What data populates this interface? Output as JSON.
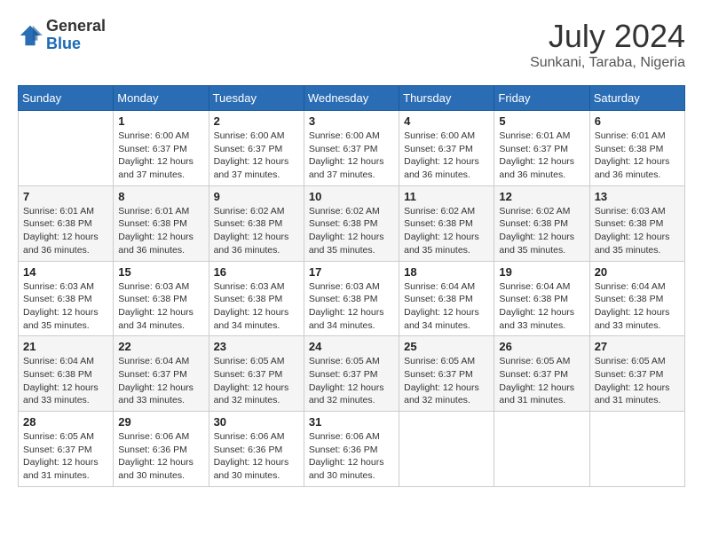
{
  "header": {
    "logo_general": "General",
    "logo_blue": "Blue",
    "month": "July 2024",
    "location": "Sunkani, Taraba, Nigeria"
  },
  "days_of_week": [
    "Sunday",
    "Monday",
    "Tuesday",
    "Wednesday",
    "Thursday",
    "Friday",
    "Saturday"
  ],
  "weeks": [
    [
      {
        "day": "",
        "sunrise": "",
        "sunset": "",
        "daylight": ""
      },
      {
        "day": "1",
        "sunrise": "Sunrise: 6:00 AM",
        "sunset": "Sunset: 6:37 PM",
        "daylight": "Daylight: 12 hours and 37 minutes."
      },
      {
        "day": "2",
        "sunrise": "Sunrise: 6:00 AM",
        "sunset": "Sunset: 6:37 PM",
        "daylight": "Daylight: 12 hours and 37 minutes."
      },
      {
        "day": "3",
        "sunrise": "Sunrise: 6:00 AM",
        "sunset": "Sunset: 6:37 PM",
        "daylight": "Daylight: 12 hours and 37 minutes."
      },
      {
        "day": "4",
        "sunrise": "Sunrise: 6:00 AM",
        "sunset": "Sunset: 6:37 PM",
        "daylight": "Daylight: 12 hours and 36 minutes."
      },
      {
        "day": "5",
        "sunrise": "Sunrise: 6:01 AM",
        "sunset": "Sunset: 6:37 PM",
        "daylight": "Daylight: 12 hours and 36 minutes."
      },
      {
        "day": "6",
        "sunrise": "Sunrise: 6:01 AM",
        "sunset": "Sunset: 6:38 PM",
        "daylight": "Daylight: 12 hours and 36 minutes."
      }
    ],
    [
      {
        "day": "7",
        "sunrise": "Sunrise: 6:01 AM",
        "sunset": "Sunset: 6:38 PM",
        "daylight": "Daylight: 12 hours and 36 minutes."
      },
      {
        "day": "8",
        "sunrise": "Sunrise: 6:01 AM",
        "sunset": "Sunset: 6:38 PM",
        "daylight": "Daylight: 12 hours and 36 minutes."
      },
      {
        "day": "9",
        "sunrise": "Sunrise: 6:02 AM",
        "sunset": "Sunset: 6:38 PM",
        "daylight": "Daylight: 12 hours and 36 minutes."
      },
      {
        "day": "10",
        "sunrise": "Sunrise: 6:02 AM",
        "sunset": "Sunset: 6:38 PM",
        "daylight": "Daylight: 12 hours and 35 minutes."
      },
      {
        "day": "11",
        "sunrise": "Sunrise: 6:02 AM",
        "sunset": "Sunset: 6:38 PM",
        "daylight": "Daylight: 12 hours and 35 minutes."
      },
      {
        "day": "12",
        "sunrise": "Sunrise: 6:02 AM",
        "sunset": "Sunset: 6:38 PM",
        "daylight": "Daylight: 12 hours and 35 minutes."
      },
      {
        "day": "13",
        "sunrise": "Sunrise: 6:03 AM",
        "sunset": "Sunset: 6:38 PM",
        "daylight": "Daylight: 12 hours and 35 minutes."
      }
    ],
    [
      {
        "day": "14",
        "sunrise": "Sunrise: 6:03 AM",
        "sunset": "Sunset: 6:38 PM",
        "daylight": "Daylight: 12 hours and 35 minutes."
      },
      {
        "day": "15",
        "sunrise": "Sunrise: 6:03 AM",
        "sunset": "Sunset: 6:38 PM",
        "daylight": "Daylight: 12 hours and 34 minutes."
      },
      {
        "day": "16",
        "sunrise": "Sunrise: 6:03 AM",
        "sunset": "Sunset: 6:38 PM",
        "daylight": "Daylight: 12 hours and 34 minutes."
      },
      {
        "day": "17",
        "sunrise": "Sunrise: 6:03 AM",
        "sunset": "Sunset: 6:38 PM",
        "daylight": "Daylight: 12 hours and 34 minutes."
      },
      {
        "day": "18",
        "sunrise": "Sunrise: 6:04 AM",
        "sunset": "Sunset: 6:38 PM",
        "daylight": "Daylight: 12 hours and 34 minutes."
      },
      {
        "day": "19",
        "sunrise": "Sunrise: 6:04 AM",
        "sunset": "Sunset: 6:38 PM",
        "daylight": "Daylight: 12 hours and 33 minutes."
      },
      {
        "day": "20",
        "sunrise": "Sunrise: 6:04 AM",
        "sunset": "Sunset: 6:38 PM",
        "daylight": "Daylight: 12 hours and 33 minutes."
      }
    ],
    [
      {
        "day": "21",
        "sunrise": "Sunrise: 6:04 AM",
        "sunset": "Sunset: 6:38 PM",
        "daylight": "Daylight: 12 hours and 33 minutes."
      },
      {
        "day": "22",
        "sunrise": "Sunrise: 6:04 AM",
        "sunset": "Sunset: 6:37 PM",
        "daylight": "Daylight: 12 hours and 33 minutes."
      },
      {
        "day": "23",
        "sunrise": "Sunrise: 6:05 AM",
        "sunset": "Sunset: 6:37 PM",
        "daylight": "Daylight: 12 hours and 32 minutes."
      },
      {
        "day": "24",
        "sunrise": "Sunrise: 6:05 AM",
        "sunset": "Sunset: 6:37 PM",
        "daylight": "Daylight: 12 hours and 32 minutes."
      },
      {
        "day": "25",
        "sunrise": "Sunrise: 6:05 AM",
        "sunset": "Sunset: 6:37 PM",
        "daylight": "Daylight: 12 hours and 32 minutes."
      },
      {
        "day": "26",
        "sunrise": "Sunrise: 6:05 AM",
        "sunset": "Sunset: 6:37 PM",
        "daylight": "Daylight: 12 hours and 31 minutes."
      },
      {
        "day": "27",
        "sunrise": "Sunrise: 6:05 AM",
        "sunset": "Sunset: 6:37 PM",
        "daylight": "Daylight: 12 hours and 31 minutes."
      }
    ],
    [
      {
        "day": "28",
        "sunrise": "Sunrise: 6:05 AM",
        "sunset": "Sunset: 6:37 PM",
        "daylight": "Daylight: 12 hours and 31 minutes."
      },
      {
        "day": "29",
        "sunrise": "Sunrise: 6:06 AM",
        "sunset": "Sunset: 6:36 PM",
        "daylight": "Daylight: 12 hours and 30 minutes."
      },
      {
        "day": "30",
        "sunrise": "Sunrise: 6:06 AM",
        "sunset": "Sunset: 6:36 PM",
        "daylight": "Daylight: 12 hours and 30 minutes."
      },
      {
        "day": "31",
        "sunrise": "Sunrise: 6:06 AM",
        "sunset": "Sunset: 6:36 PM",
        "daylight": "Daylight: 12 hours and 30 minutes."
      },
      {
        "day": "",
        "sunrise": "",
        "sunset": "",
        "daylight": ""
      },
      {
        "day": "",
        "sunrise": "",
        "sunset": "",
        "daylight": ""
      },
      {
        "day": "",
        "sunrise": "",
        "sunset": "",
        "daylight": ""
      }
    ]
  ]
}
